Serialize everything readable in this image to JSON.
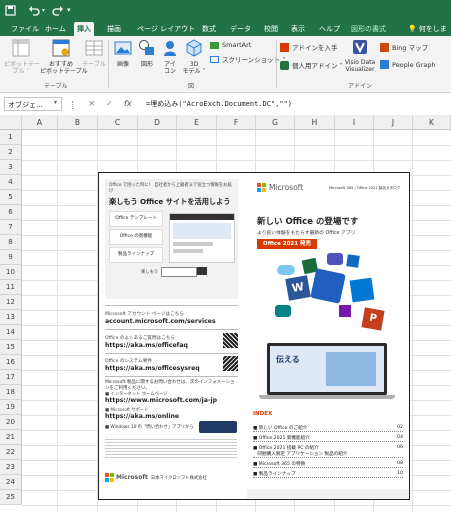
{
  "quick_access": {
    "save_icon": "save-icon",
    "undo_icon": "undo-icon",
    "redo_icon": "redo-icon"
  },
  "tabs": [
    {
      "label": "ファイル",
      "active": false
    },
    {
      "label": "ホーム",
      "active": false
    },
    {
      "label": "挿入",
      "active": true
    },
    {
      "label": "描画",
      "active": false
    },
    {
      "label": "ページ レイアウト",
      "active": false
    },
    {
      "label": "数式",
      "active": false
    },
    {
      "label": "データ",
      "active": false
    },
    {
      "label": "校閲",
      "active": false
    },
    {
      "label": "表示",
      "active": false
    },
    {
      "label": "ヘルプ",
      "active": false
    },
    {
      "label": "図形の書式",
      "active": false,
      "contextual": true
    }
  ],
  "tell_me": "何をしま",
  "ribbon": {
    "pivot_table": "ピボットテー\nブル ˅",
    "recommended_pivot": "おすすめ\nピボットテーブル",
    "table": "テーブル",
    "group_table": "テーブル",
    "image": "画像",
    "shapes": "図形",
    "icons": "アイ\nコン",
    "models_3d": "3D\nモデル ˅",
    "smartart": "SmartArt",
    "screenshot": "スクリーンショット ˅",
    "group_figure": "図",
    "get_addins": "アドインを入手",
    "my_addins": "個人用アドイン ˅",
    "visio": "Visio Data\nVisualizer",
    "bing_maps": "Bing マップ",
    "people_graph": "People Graph",
    "group_addins": "アドイン"
  },
  "formula_bar": {
    "name_box": "オブジェ...",
    "cancel": "×",
    "enter": "✓",
    "fx": "fx",
    "formula": "=埋め込み(\"AcroExch.Document.DC\",\"\")"
  },
  "columns": [
    "A",
    "B",
    "C",
    "D",
    "E",
    "F",
    "G",
    "H",
    "I",
    "J",
    "K"
  ],
  "rows": [
    "1",
    "2",
    "3",
    "4",
    "5",
    "6",
    "7",
    "8",
    "9",
    "10",
    "11",
    "12",
    "13",
    "14",
    "15",
    "16",
    "17",
    "18",
    "19",
    "20",
    "21",
    "22",
    "23",
    "24",
    "25"
  ],
  "doc": {
    "left": {
      "tip1": "Office で困った時に！ 自社者から上級者まで役立つ情報をお届け",
      "tip_title": "楽しもう Office サイトを活用しよう",
      "card1": "Office テンプレート",
      "card2": "Office の新機能",
      "card3": "製品ラインナップ",
      "search_label": "楽しもう",
      "link1_label": "Microsoft アカウント ページはこちら",
      "link1_url": "account.microsoft.com/services",
      "link2_label": "Office のよくあるご質問はこちら",
      "link2_url": "https://aka.ms/officefaq",
      "link3_label": "Office のシステム要件",
      "link3_url": "https://aka.ms/officesysreq",
      "link4_label": "Microsoft 製品に関するお問い合わせは、次のインフォメーションをご利用ください。",
      "link4_sub": "■ インターネット ホームページ",
      "link4_url": "https://www.microsoft.com/ja-jp",
      "link5_sub": "■ Microsoft サポート",
      "link5_url": "https://aka.ms/online",
      "link6": "■ Windows 10 の「問い合わせ」アプリから",
      "footer_brand": "Microsoft",
      "footer_company": "日本マイクロソフト株式会社"
    },
    "right": {
      "brand": "Microsoft",
      "catalog": "Microsoft 365 / Office 2021 製品カタログ",
      "headline": "新しい Office の登場です",
      "subline": "より良い体験をもたらす最新の Office アプリ",
      "badge": "Office 2021 発売",
      "laptop_text": "伝える",
      "index_title": "INDEX",
      "index": [
        {
          "label": "■ 新しい Office のご紹介",
          "page": "02"
        },
        {
          "label": "■ Office 2021 新機能紹介",
          "page": "04"
        },
        {
          "label": "■ Office 2021 搭載 PC の紹介\n   同梱購入限定 アプリケーション 製品の紹介",
          "page": "06"
        },
        {
          "label": "■ Microsoft 365 の特徴",
          "page": "08"
        },
        {
          "label": "■ 製品ラインナップ",
          "page": "10"
        }
      ]
    }
  }
}
